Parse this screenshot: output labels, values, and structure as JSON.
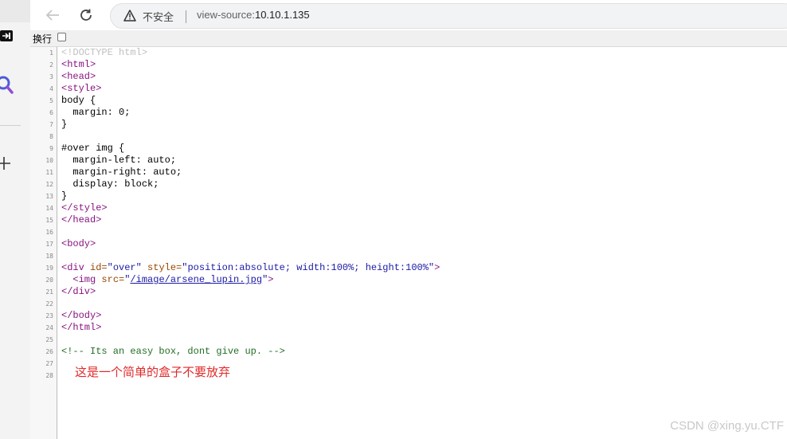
{
  "toolbar": {
    "security_label": "不安全",
    "url_scheme": "view-source:",
    "url_host": "10.10.1.135"
  },
  "wrapbar": {
    "label": "换行"
  },
  "source": {
    "line_numbers": [
      "1",
      "2",
      "3",
      "4",
      "5",
      "6",
      "7",
      "8",
      "9",
      "10",
      "11",
      "12",
      "13",
      "14",
      "15",
      "16",
      "17",
      "18",
      "19",
      "20",
      "21",
      "22",
      "23",
      "24",
      "25",
      "26",
      "27",
      "28"
    ],
    "l1": "<!DOCTYPE html>",
    "l2": "<html>",
    "l3": "<head>",
    "l4": "<style>",
    "l5": "body {",
    "l6": "  margin: 0;",
    "l7": "}",
    "l9": "#over img {",
    "l10": "  margin-left: auto;",
    "l11": "  margin-right: auto;",
    "l12": "  display: block;",
    "l13": "}",
    "l14": "</style>",
    "l15": "</head>",
    "l17": "<body>",
    "l19_open": "<div ",
    "l19_a1": "id=",
    "l19_v1": "\"over\"",
    "l19_a2": " style=",
    "l19_v2": "\"position:absolute; width:100%; height:100%\"",
    "l19_close": ">",
    "l20_open": "  <img ",
    "l20_a1": "src=",
    "l20_q1": "\"",
    "l20_link": "/image/arsene_lupin.jpg",
    "l20_q2": "\"",
    "l20_close": ">",
    "l21": "</div>",
    "l23": "</body>",
    "l24": "</html>",
    "l26": "<!-- Its an easy box, dont give up. -->"
  },
  "annotation": {
    "text": "这是一个简单的盒子不要放弃"
  },
  "watermark": {
    "text": "CSDN @xing.yu.CTF"
  },
  "colors": {
    "tag": "#881280",
    "comment": "#236e25",
    "attr": "#994500",
    "value": "#1a1aa6",
    "annotation": "#e02a2a"
  }
}
